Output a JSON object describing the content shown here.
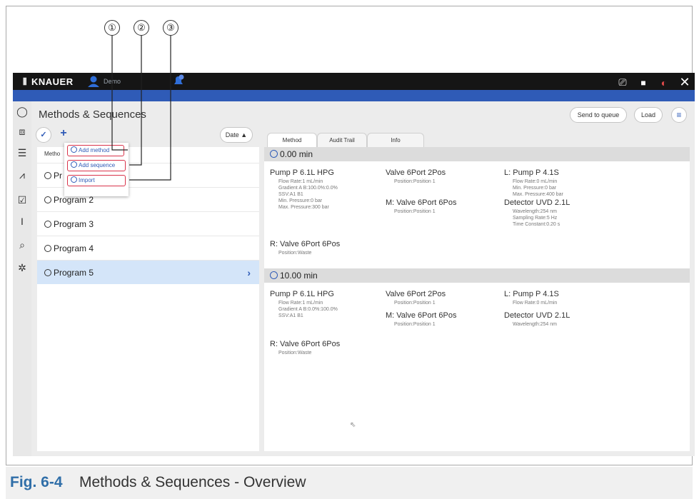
{
  "callouts": [
    "①",
    "②",
    "③"
  ],
  "caption": {
    "number": "Fig. 6-4",
    "text": "Methods & Sequences - Overview"
  },
  "titlebar": {
    "brand": "KNAUER",
    "user": "Demo"
  },
  "header": {
    "title": "Methods & Sequences",
    "send_to_queue": "Send to queue",
    "load": "Load"
  },
  "toolbar": {
    "sort_label": "Date ▲"
  },
  "left_panel": {
    "tab_label": "Metho",
    "programs": [
      "Pr",
      "Program 2",
      "Program 3",
      "Program 4",
      "Program 5"
    ]
  },
  "menu": [
    "Add method",
    "Add sequence",
    "Import"
  ],
  "tabs": [
    "Method",
    "Audit Trail",
    "Info"
  ],
  "timeline": [
    {
      "time": "0.00 min",
      "devices": [
        {
          "name": "Pump P 6.1L HPG",
          "params": [
            "Flow Rate:1 mL/min",
            "Gradient A B:100.0%:0.0%",
            "SSV:A1 B1",
            "Min. Pressure:0 bar",
            "Max. Pressure:300 bar"
          ]
        },
        {
          "name": "Valve 6Port 2Pos",
          "params": [
            "Position:Position 1"
          ]
        },
        {
          "name": "L: Pump P 4.1S",
          "params": [
            "Flow Rate:0 mL/min",
            "Min. Pressure:0 bar",
            "Max. Pressure:400 bar"
          ]
        },
        {
          "name": "M: Valve 6Port 6Pos",
          "params": [
            "Position:Position 1"
          ]
        },
        {
          "name": "Detector UVD 2.1L",
          "params": [
            "Wavelength:254 nm",
            "Sampling Rate:5 Hz",
            "Time Constant:0.20 s"
          ]
        },
        {
          "name": "R: Valve 6Port 6Pos",
          "params": [
            "Position:Waste"
          ]
        }
      ]
    },
    {
      "time": "10.00 min",
      "devices": [
        {
          "name": "Pump P 6.1L HPG",
          "params": [
            "Flow Rate:1 mL/min",
            "Gradient A B:0.0%:100.0%",
            "SSV:A1 B1"
          ]
        },
        {
          "name": "Valve 6Port 2Pos",
          "params": [
            "Position:Position 1"
          ]
        },
        {
          "name": "L: Pump P 4.1S",
          "params": [
            "Flow Rate:0 mL/min"
          ]
        },
        {
          "name": "M: Valve 6Port 6Pos",
          "params": [
            "Position:Position 1"
          ]
        },
        {
          "name": "Detector UVD 2.1L",
          "params": [
            "Wavelength:254 nm"
          ]
        },
        {
          "name": "R: Valve 6Port 6Pos",
          "params": [
            "Position:Waste"
          ]
        }
      ]
    }
  ],
  "colors": {
    "accent": "#2f5bb7",
    "highlight": "#d9334a",
    "caption_number": "#2f6ea8"
  }
}
